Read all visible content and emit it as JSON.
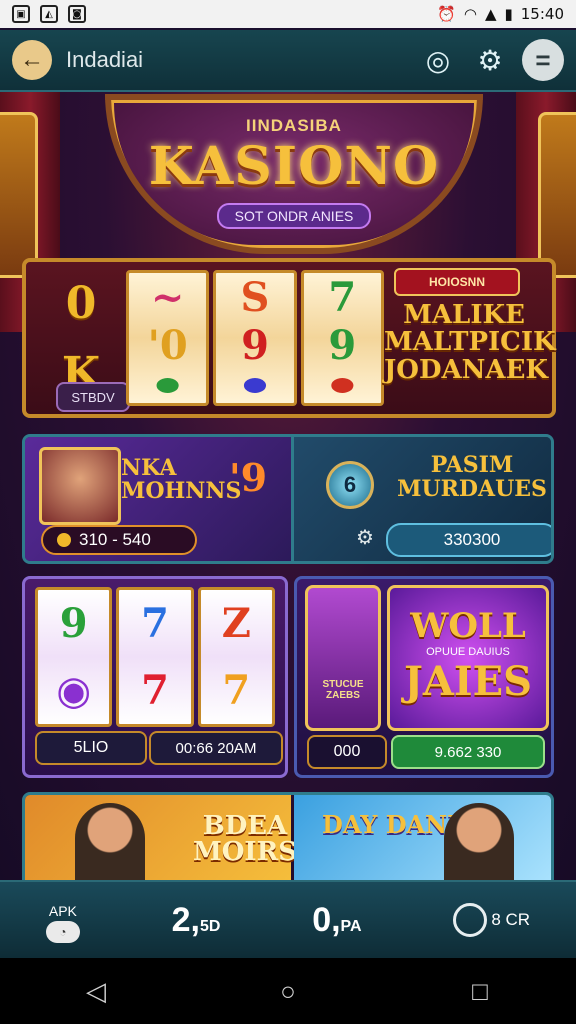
{
  "status": {
    "time": "15:40"
  },
  "header": {
    "title": "Indadiai"
  },
  "hero": {
    "subtitle": "IINDASIBA",
    "title": "KASIONO",
    "pill": "SOT ONDR ANIES"
  },
  "slot_panel": {
    "left_symbols": [
      "0",
      "K"
    ],
    "reel1": [
      "~",
      "'0",
      ""
    ],
    "reel2": [
      "S",
      "9",
      ""
    ],
    "reel3": [
      "7",
      "9",
      ""
    ],
    "spin_label": "STBDV",
    "promo_badge": "HOIOSNN",
    "promo_text": "MALIKE MALTPICIK JODANAEK"
  },
  "row2": {
    "left_title": "NKA MOHNNS",
    "left_number": "'9",
    "bet_range": "310 - 540",
    "right_icon": "6",
    "right_title": "PASIM MURDAUES",
    "right_value": "330300"
  },
  "row3": {
    "reels": [
      "9",
      "7",
      "Z",
      "",
      "7",
      "7"
    ],
    "pill_a": "5LIO",
    "pill_b": "00:66 20AM",
    "char_caption": "STUCUE ZAEBS",
    "wild_title": "WOLL",
    "wild_sub": "OPUUE DAUIUS",
    "wild_title2": "JAIES",
    "right_pill_a": "000",
    "right_pill_b": "9.662 330"
  },
  "row4": {
    "left_title": "BDEA MOIRS",
    "right_title": "DAY DANES"
  },
  "bottom": {
    "apk_label": "APK",
    "stat_a": "2,",
    "stat_a_small": "5D",
    "stat_b": "0,",
    "stat_b_small": "PA",
    "right_label": "8 CR"
  }
}
